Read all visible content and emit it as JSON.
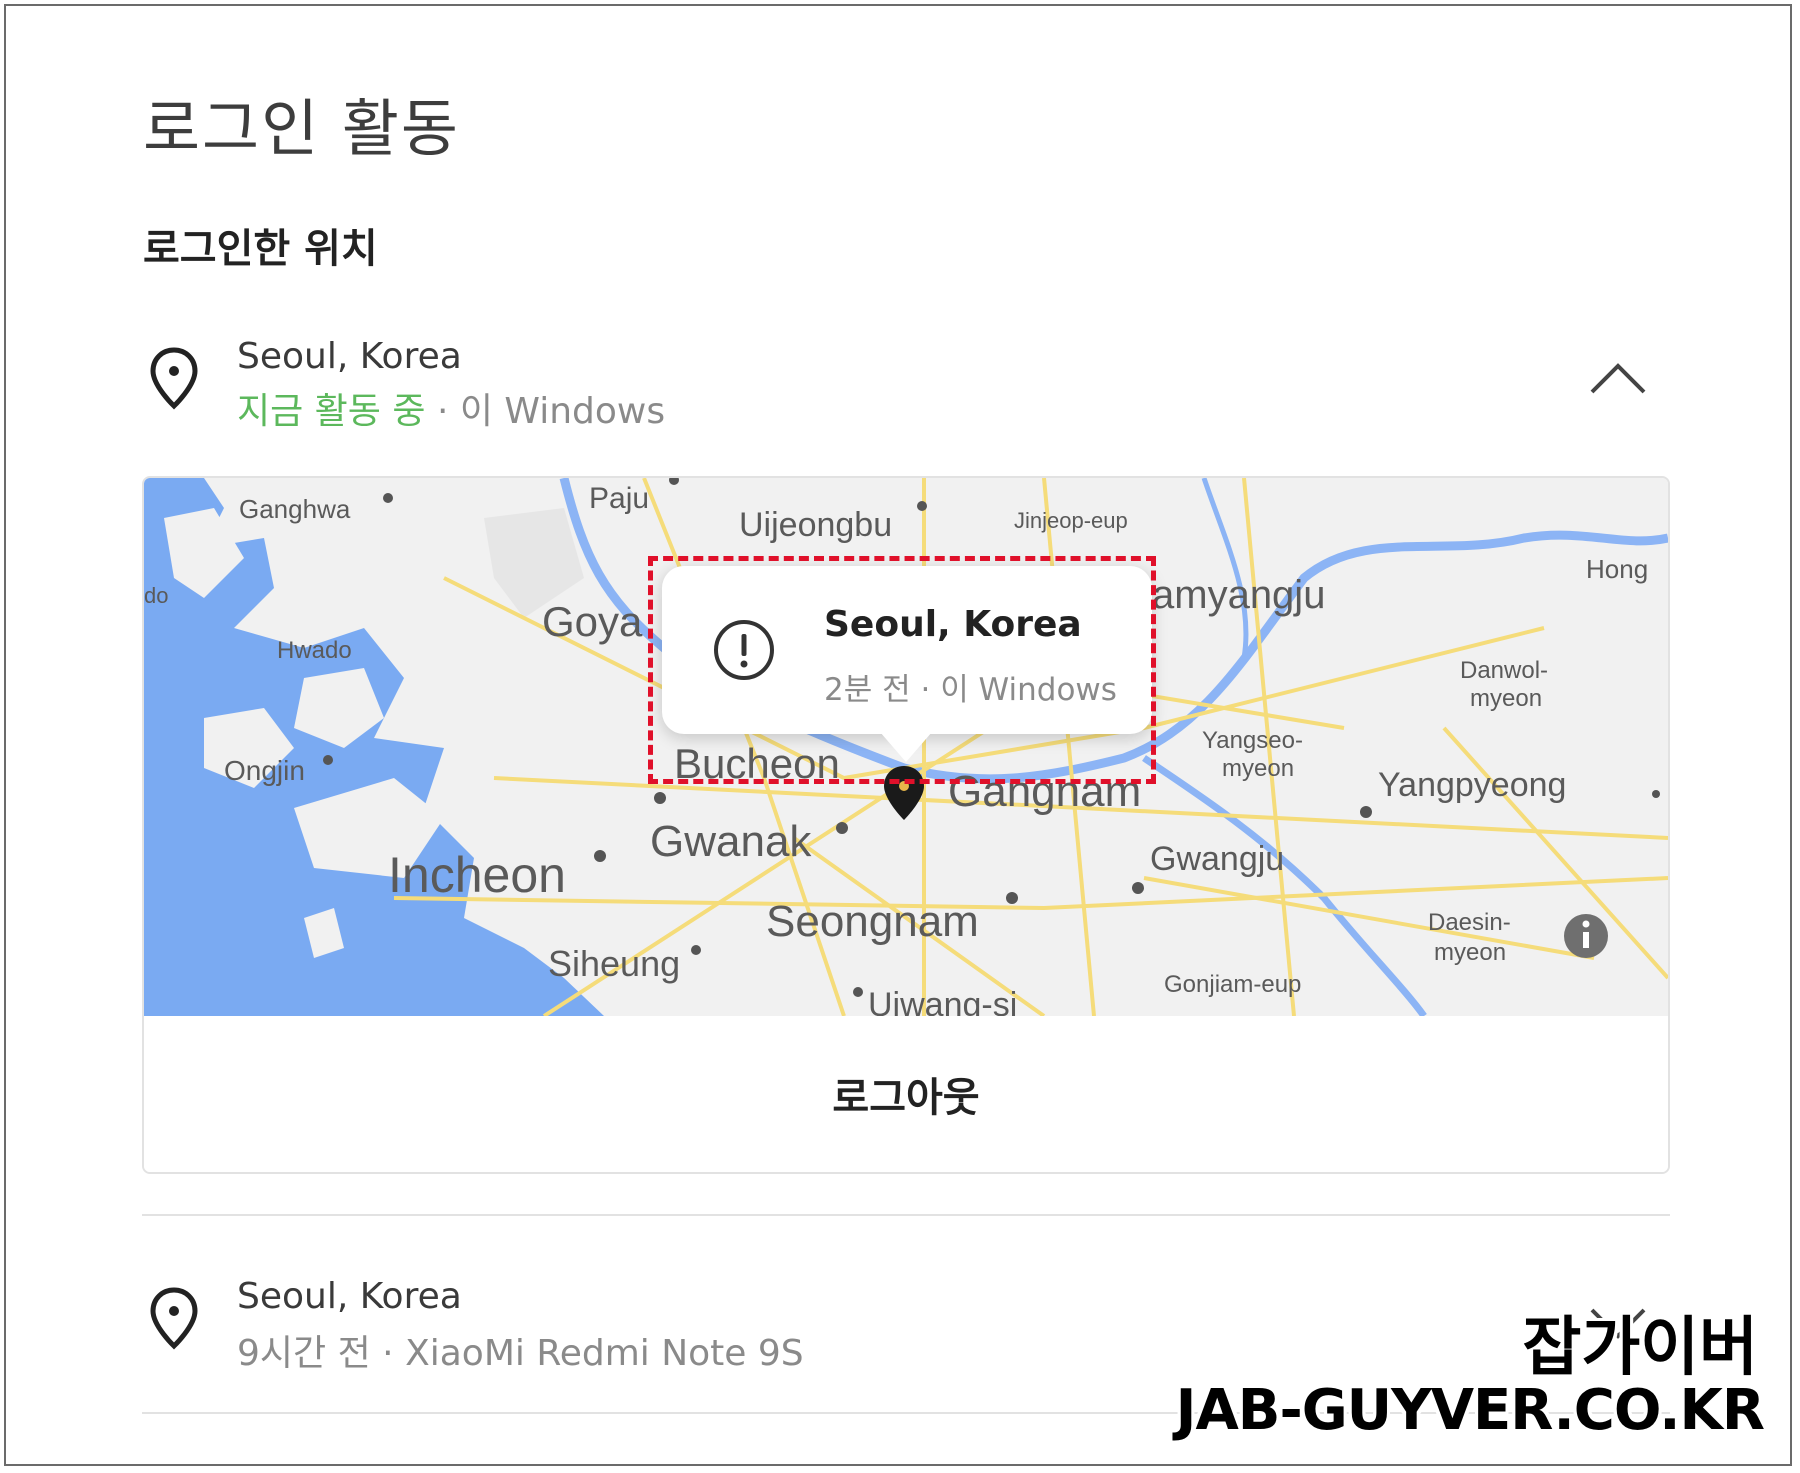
{
  "page": {
    "title": "로그인 활동"
  },
  "section": {
    "title": "로그인한 위치"
  },
  "sessions": [
    {
      "city": "Seoul, Korea",
      "status": "지금 활동 중",
      "separator": " · ",
      "device": "이 Windows",
      "status_color": "#5cb85c"
    },
    {
      "city": "Seoul, Korea",
      "time": "9시간 전",
      "separator": " · ",
      "device": "XiaoMi Redmi Note 9S"
    }
  ],
  "map": {
    "labels": {
      "ganghwa": "Ganghwa",
      "paju": "Paju",
      "uijeongbu": "Uijeongbu",
      "jinjeop": "Jinjeop-eup",
      "hong": "Hong",
      "goyang": "Goya",
      "namyangju": "amyangju",
      "hwado": "Hwado",
      "danwol": "Danwol-",
      "danwol2": "myeon",
      "ongjin": "Ongjin",
      "yangseo": "Yangseo-",
      "yangseo2": "myeon",
      "bucheon": "Bucheon",
      "gangnam": "Gangnam",
      "yangpyeong": "Yangpyeong",
      "gwanak": "Gwanak",
      "incheon": "Incheon",
      "gwangju": "Gwangju",
      "seongnam": "Seongnam",
      "daesin": "Daesin-",
      "daesin2": "myeon",
      "siheung": "Siheung",
      "gonjiam": "Gonjiam-eup",
      "uiwang": "Uiwang-si",
      "edge_do": "do"
    },
    "colors": {
      "water": "#7aaaf2",
      "land": "#f2f2f2",
      "road": "#f5dc7a",
      "river": "#8cb4f5"
    }
  },
  "tooltip": {
    "title": "Seoul, Korea",
    "time": "2분 전",
    "separator": " · ",
    "device": "이 Windows"
  },
  "actions": {
    "logout": "로그아웃"
  },
  "icons": {
    "location": "location-pin-icon",
    "chevron_up": "chevron-up-icon",
    "chevron_down": "chevron-down-icon",
    "alert": "alert-circle-icon",
    "info": "info-icon",
    "map_pin": "map-pin-icon"
  },
  "watermark": {
    "korean": "잡가이버",
    "url": "JAB-GUYVER.CO.KR"
  }
}
